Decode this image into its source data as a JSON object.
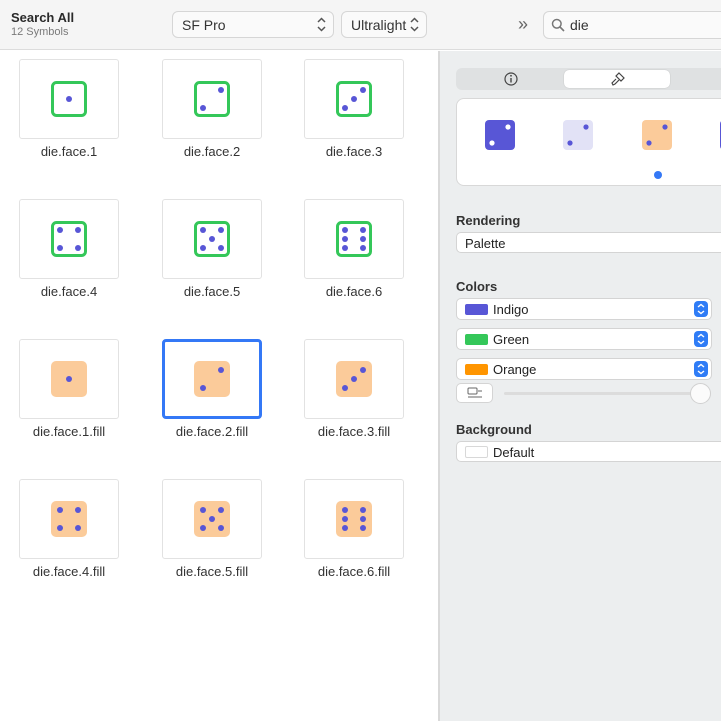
{
  "header": {
    "title": "Search All",
    "subtitle": "12 Symbols",
    "font_family_popup": "SF Pro",
    "weight_popup": "Ultralight",
    "search_value": "die"
  },
  "symbols": [
    {
      "label": "die.face.1",
      "pips": 1,
      "filled": false,
      "selected": false
    },
    {
      "label": "die.face.2",
      "pips": 2,
      "filled": false,
      "selected": false
    },
    {
      "label": "die.face.3",
      "pips": 3,
      "filled": false,
      "selected": false
    },
    {
      "label": "die.face.4",
      "pips": 4,
      "filled": false,
      "selected": false
    },
    {
      "label": "die.face.5",
      "pips": 5,
      "filled": false,
      "selected": false
    },
    {
      "label": "die.face.6",
      "pips": 6,
      "filled": false,
      "selected": false
    },
    {
      "label": "die.face.1.fill",
      "pips": 1,
      "filled": true,
      "selected": false
    },
    {
      "label": "die.face.2.fill",
      "pips": 2,
      "filled": true,
      "selected": true
    },
    {
      "label": "die.face.3.fill",
      "pips": 3,
      "filled": true,
      "selected": false
    },
    {
      "label": "die.face.4.fill",
      "pips": 4,
      "filled": true,
      "selected": false
    },
    {
      "label": "die.face.5.fill",
      "pips": 5,
      "filled": true,
      "selected": false
    },
    {
      "label": "die.face.6.fill",
      "pips": 6,
      "filled": true,
      "selected": false
    }
  ],
  "inspector": {
    "rendering_label": "Rendering",
    "rendering_value": "Palette",
    "colors_label": "Colors",
    "colors": [
      {
        "name": "Indigo",
        "hex": "#5856d6"
      },
      {
        "name": "Green",
        "hex": "#34c759"
      },
      {
        "name": "Orange",
        "hex": "#ff9500"
      }
    ],
    "background_label": "Background",
    "background_value": "Default"
  },
  "palette": {
    "indigo": "#5856d6",
    "green": "#34c759",
    "orange_fill": "#fbcb9a",
    "light_indigo": "#e2e2f6",
    "accent_blue": "#3478f6"
  }
}
